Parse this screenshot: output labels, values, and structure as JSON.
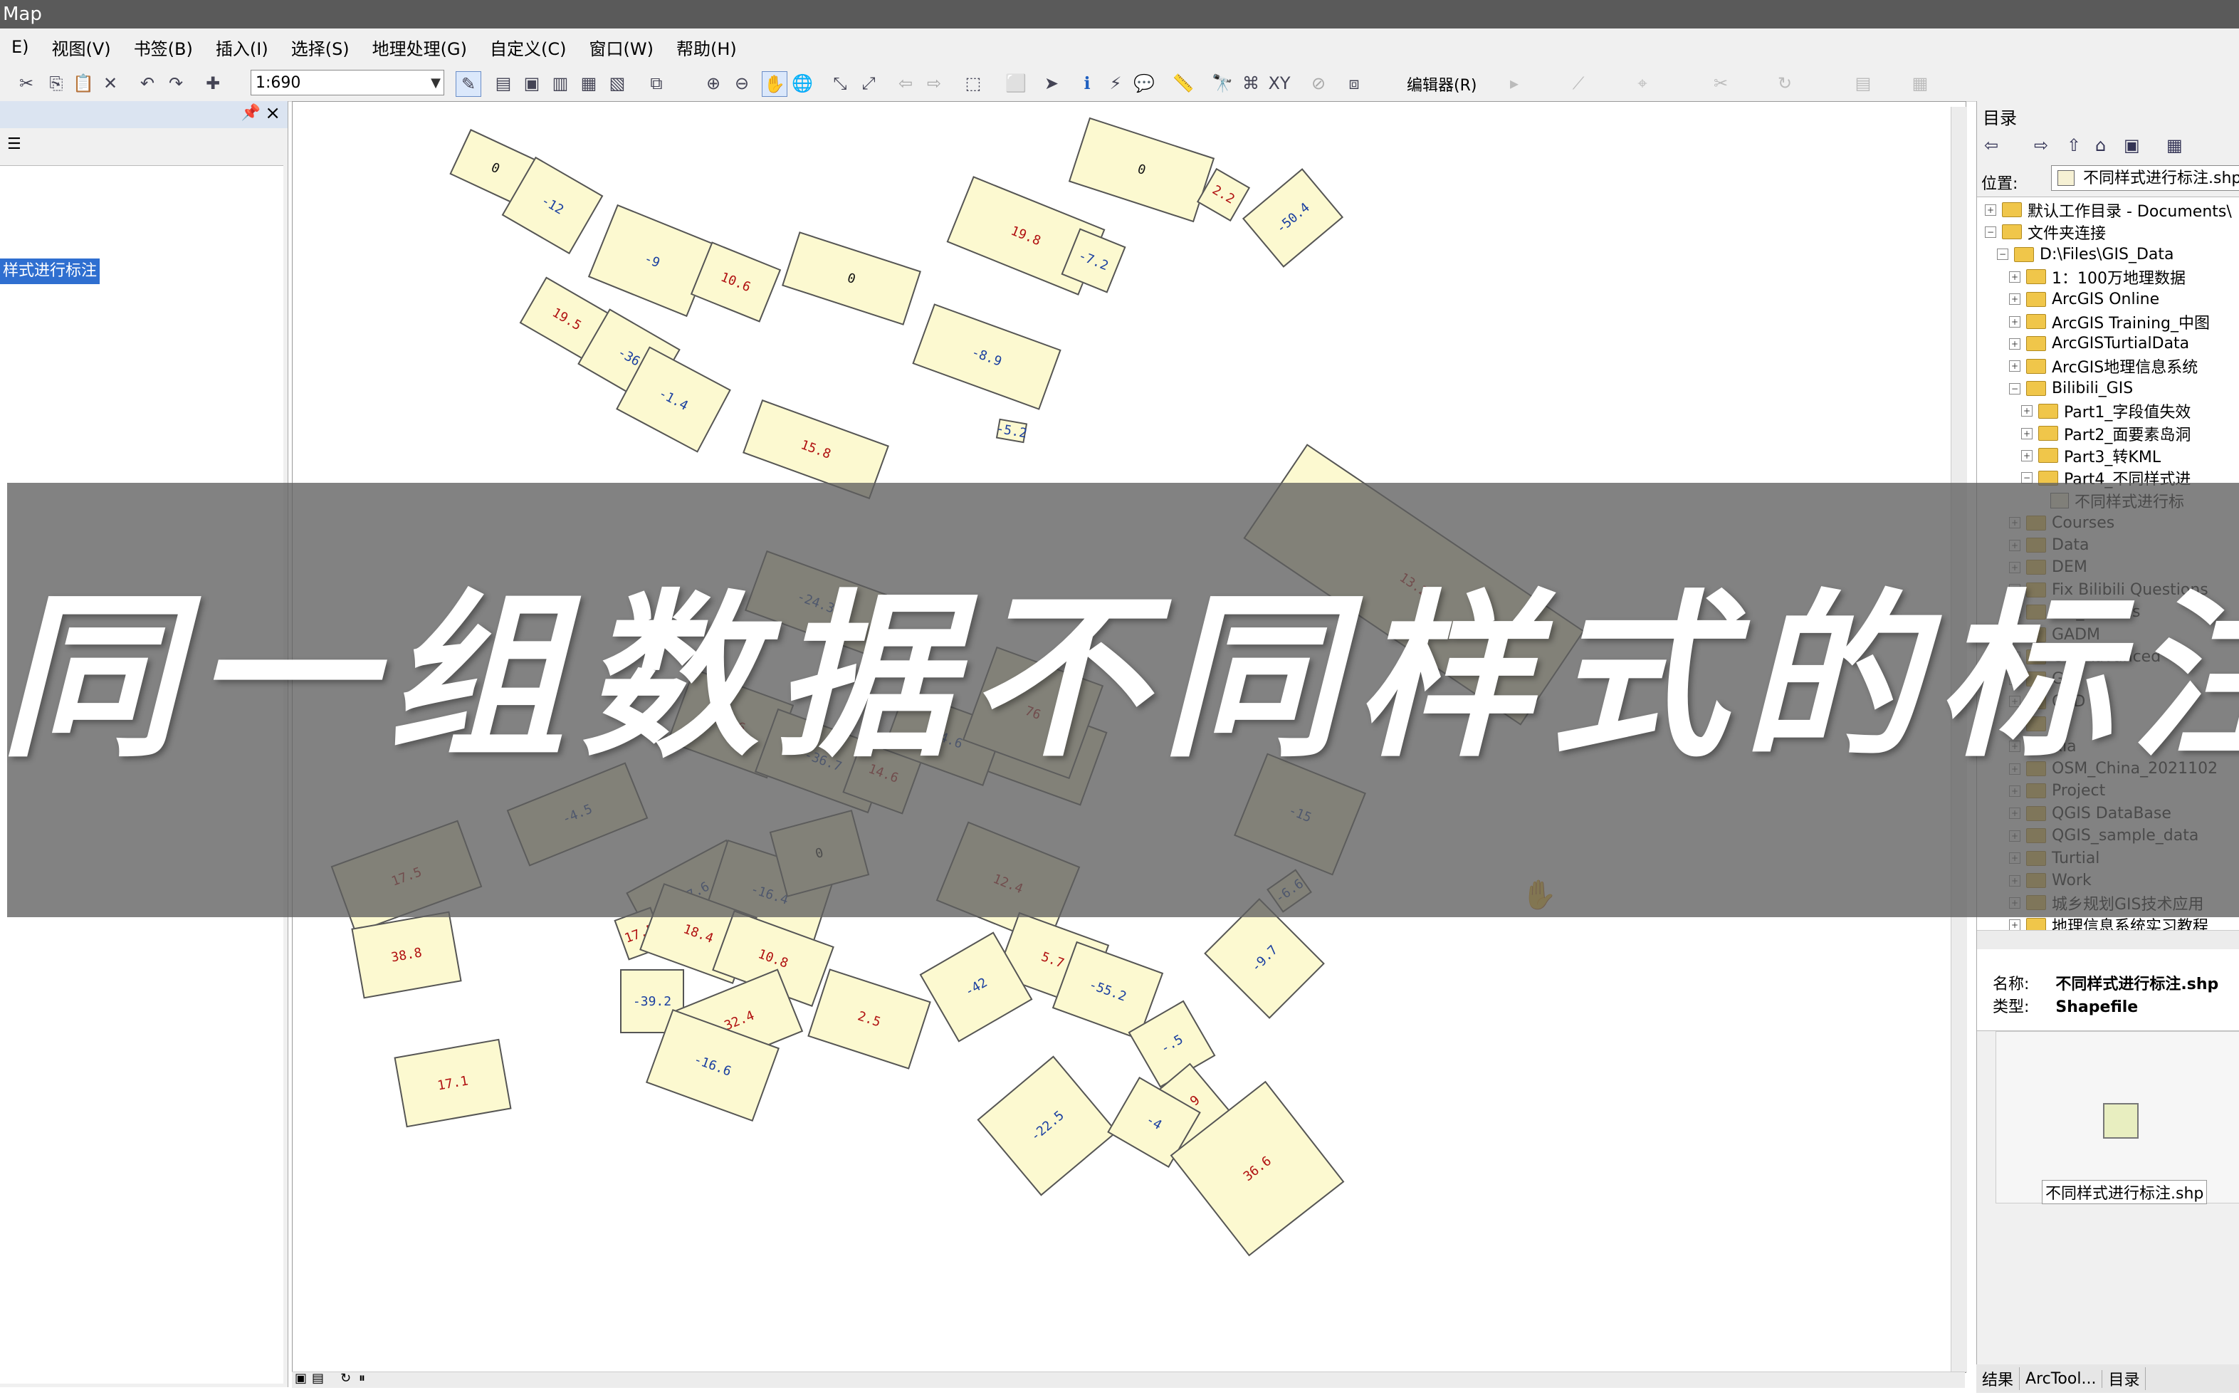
{
  "window": {
    "title": "Map"
  },
  "menu": [
    "E)",
    "视图(V)",
    "书签(B)",
    "插入(I)",
    "选择(S)",
    "地理处理(G)",
    "自定义(C)",
    "窗口(W)",
    "帮助(H)"
  ],
  "toolbar": {
    "scale": "1:690",
    "editor": "编辑器(R)"
  },
  "toc": {
    "selected_layer": "样式进行标注"
  },
  "catalog": {
    "title": "目录",
    "location_label": "位置:",
    "location_value": "不同样式进行标注.shp",
    "tree": [
      "默认工作目录 - Documents\\",
      "文件夹连接",
      "D:\\Files\\GIS_Data",
      "1：100万地理数据",
      "ArcGIS Online",
      "ArcGIS Training_中图",
      "ArcGISTurtialData",
      "ArcGIS地理信息系统",
      "Bilibili_GIS",
      "Part1_字段值失效",
      "Part2_面要素岛洞",
      "Part3_转KML",
      "Part4_不同样式进",
      "不同样式进行标",
      "Courses",
      "Data",
      "DEM",
      "Fix Bilibili Questions",
      "For_Friends",
      "GADM",
      "GIS Advanced",
      "GIS",
      "CAD",
      "0",
      "Xia",
      "OSM_China_2021102",
      "Project",
      "QGIS DataBase",
      "QGIS_sample_data",
      "Turtial",
      "Work",
      "城乡规划GIS技术应用",
      "地理信息系统实习教程"
    ],
    "name_label": "名称:",
    "name_value": "不同样式进行标注.shp",
    "type_label": "类型:",
    "type_value": "Shapefile",
    "preview_label": "不同样式进行标注.shp"
  },
  "bottom_tabs": [
    "结果",
    "ArcTool...",
    "目录"
  ],
  "banner": {
    "text": "同一组数据不同样式的标注"
  },
  "map_labels": [
    {
      "t": "0",
      "c": "black"
    },
    {
      "t": "-12",
      "c": "blue"
    },
    {
      "t": "-9",
      "c": "blue"
    },
    {
      "t": "10.6",
      "c": "red"
    },
    {
      "t": "0",
      "c": "black"
    },
    {
      "t": "19.8",
      "c": "red"
    },
    {
      "t": "-7.2",
      "c": "blue"
    },
    {
      "t": "0",
      "c": "black"
    },
    {
      "t": "2.2",
      "c": "red"
    },
    {
      "t": "-50.4",
      "c": "blue"
    },
    {
      "t": "19.5",
      "c": "red"
    },
    {
      "t": "-36",
      "c": "blue"
    },
    {
      "t": "-1.4",
      "c": "blue"
    },
    {
      "t": "15.8",
      "c": "red"
    },
    {
      "t": "-8.9",
      "c": "blue"
    },
    {
      "t": "-5.2",
      "c": "blue"
    },
    {
      "t": "13.2",
      "c": "red"
    },
    {
      "t": "-24.3",
      "c": "blue"
    },
    {
      "t": "57.6",
      "c": "red"
    },
    {
      "t": "-36.7",
      "c": "blue"
    },
    {
      "t": "14.6",
      "c": "red"
    },
    {
      "t": "-14.6",
      "c": "blue"
    },
    {
      "t": "-40.5",
      "c": "blue"
    },
    {
      "t": "76",
      "c": "red"
    },
    {
      "t": "-4.5",
      "c": "blue"
    },
    {
      "t": "-15",
      "c": "blue"
    },
    {
      "t": "17.5",
      "c": "red"
    },
    {
      "t": "-47.6",
      "c": "blue"
    },
    {
      "t": "17.5",
      "c": "red"
    },
    {
      "t": "-16.4",
      "c": "blue"
    },
    {
      "t": "0",
      "c": "black"
    },
    {
      "t": "12.4",
      "c": "red"
    },
    {
      "t": "-6.6",
      "c": "blue"
    },
    {
      "t": "38.8",
      "c": "red"
    },
    {
      "t": "18.4",
      "c": "red"
    },
    {
      "t": "10.8",
      "c": "red"
    },
    {
      "t": "5.7",
      "c": "red"
    },
    {
      "t": "-9.7",
      "c": "blue"
    },
    {
      "t": "-39.2",
      "c": "blue"
    },
    {
      "t": "-42",
      "c": "blue"
    },
    {
      "t": "-55.2",
      "c": "blue"
    },
    {
      "t": "32.4",
      "c": "red"
    },
    {
      "t": "2.5",
      "c": "red"
    },
    {
      "t": "-.5",
      "c": "blue"
    },
    {
      "t": "17.1",
      "c": "red"
    },
    {
      "t": "-16.6",
      "c": "blue"
    },
    {
      "t": "63.9",
      "c": "red"
    },
    {
      "t": "-22.5",
      "c": "blue"
    },
    {
      "t": "-4",
      "c": "blue"
    },
    {
      "t": "36.6",
      "c": "red"
    }
  ]
}
